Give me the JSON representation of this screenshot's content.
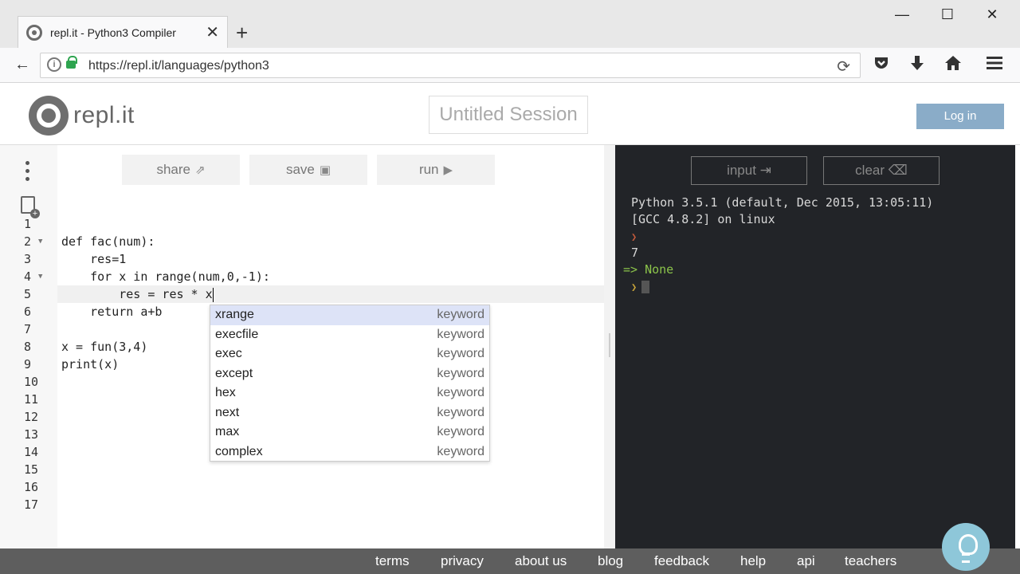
{
  "browser": {
    "tab_title": "repl.it - Python3 Compiler",
    "tab_close": "✕",
    "new_tab": "+",
    "url": "https://repl.it/languages/python3",
    "window_controls": [
      "—",
      "☐",
      "✕"
    ]
  },
  "header": {
    "logo_text": "repl.it",
    "session_title": "Untitled Session",
    "login_label": "Log in"
  },
  "toolbar": {
    "share_label": "share",
    "save_label": "save",
    "run_label": "run"
  },
  "editor": {
    "line_numbers": [
      "1",
      "2",
      "3",
      "4",
      "5",
      "6",
      "7",
      "8",
      "9",
      "10",
      "11",
      "12",
      "13",
      "14",
      "15",
      "16",
      "17"
    ],
    "lines": [
      "",
      "def fac(num):",
      "    res=1",
      "    for x in range(num,0,-1):",
      "        res = res * x",
      "    return a+b",
      "",
      "x = fun(3,4)",
      "print(x)",
      "",
      "",
      "",
      "",
      "",
      "",
      "",
      ""
    ],
    "active_line": 5
  },
  "autocomplete": {
    "items": [
      {
        "word": "xrange",
        "type": "keyword"
      },
      {
        "word": "execfile",
        "type": "keyword"
      },
      {
        "word": "exec",
        "type": "keyword"
      },
      {
        "word": "except",
        "type": "keyword"
      },
      {
        "word": "hex",
        "type": "keyword"
      },
      {
        "word": "next",
        "type": "keyword"
      },
      {
        "word": "max",
        "type": "keyword"
      },
      {
        "word": "complex",
        "type": "keyword"
      }
    ],
    "selected_index": 0
  },
  "console": {
    "input_label": "input",
    "clear_label": "clear",
    "banner_1": "Python 3.5.1 (default, Dec 2015, 13:05:11)",
    "banner_2": "[GCC 4.8.2] on linux",
    "output_value": "7",
    "result_line": "=> None"
  },
  "footer": {
    "links": [
      "terms",
      "privacy",
      "about us",
      "blog",
      "feedback",
      "help",
      "api",
      "teachers"
    ]
  }
}
